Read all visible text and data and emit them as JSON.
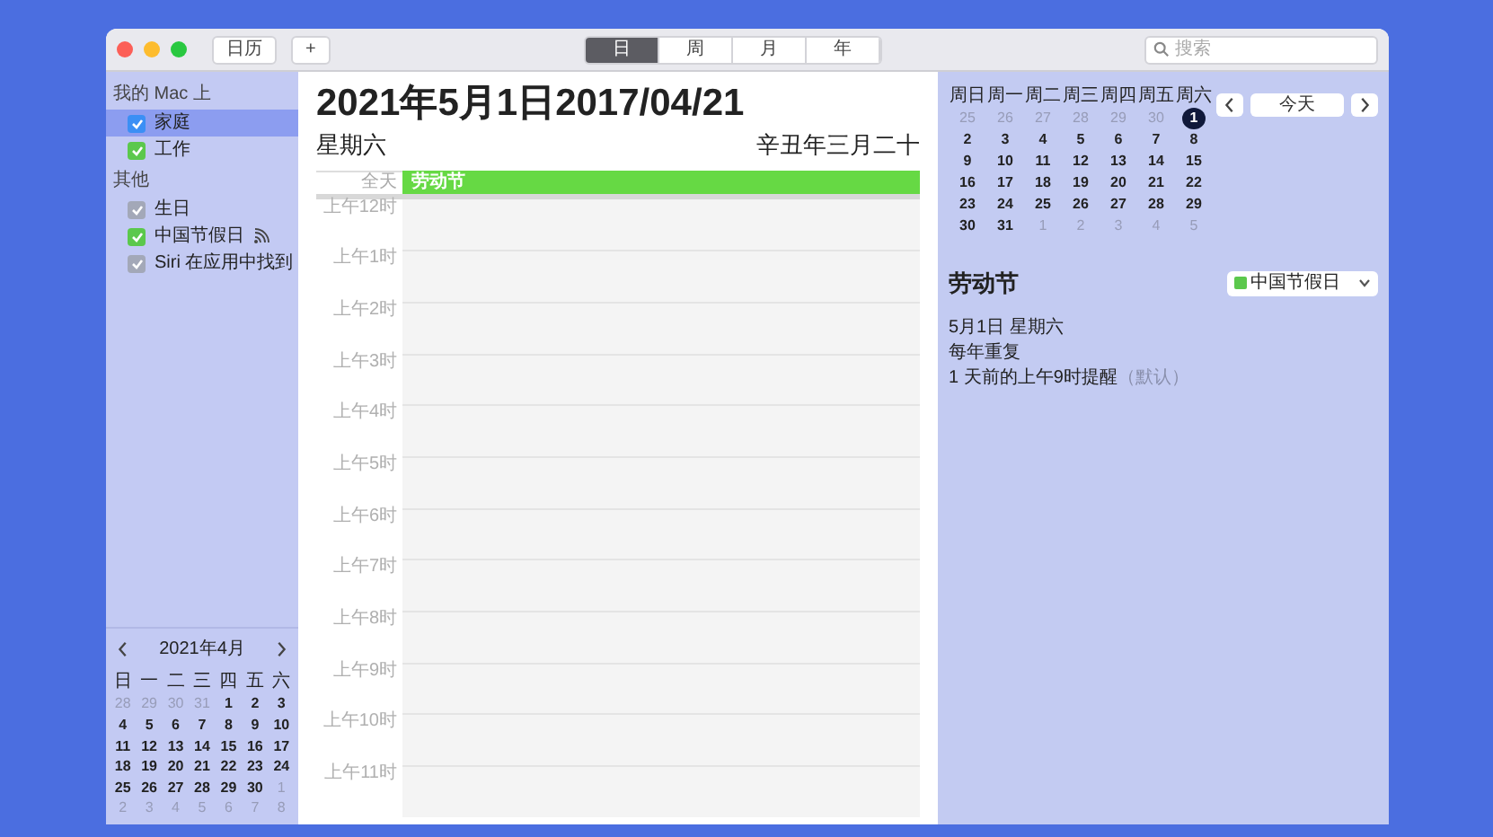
{
  "toolbar": {
    "buttons": [
      {
        "kind": "text",
        "label": "日历"
      },
      {
        "kind": "text",
        "label": "+"
      }
    ],
    "view_tabs": [
      {
        "label": "日",
        "selected": true
      },
      {
        "label": "周",
        "selected": false
      },
      {
        "label": "月",
        "selected": false
      },
      {
        "label": "年",
        "selected": false
      }
    ],
    "search": {
      "placeholder": "搜索"
    }
  },
  "sidebar": {
    "groups": [
      {
        "title": "我的 Mac 上",
        "items": [
          {
            "label": "家庭",
            "checked": true,
            "color": "#3b8ff5",
            "selected": true,
            "subscribed": false
          },
          {
            "label": "工作",
            "checked": true,
            "color": "#5bc84c",
            "selected": false,
            "subscribed": false
          }
        ]
      },
      {
        "title": "其他",
        "items": [
          {
            "label": "生日",
            "checked": true,
            "color": "#a3a8b8",
            "selected": false,
            "subscribed": false
          },
          {
            "label": "中国节假日",
            "checked": true,
            "color": "#5bc84c",
            "selected": false,
            "subscribed": true
          },
          {
            "label": "Siri 在应用中找到",
            "checked": true,
            "color": "#a3a8b8",
            "selected": false,
            "subscribed": false
          }
        ]
      }
    ],
    "mini_calendar": {
      "title": "2021年4月",
      "weekdays": [
        "日",
        "一",
        "二",
        "三",
        "四",
        "五",
        "六"
      ],
      "days": [
        {
          "text": "28",
          "current_month": false
        },
        {
          "text": "29",
          "current_month": false
        },
        {
          "text": "30",
          "current_month": false
        },
        {
          "text": "31",
          "current_month": false
        },
        {
          "text": "1",
          "current_month": true
        },
        {
          "text": "2",
          "current_month": true
        },
        {
          "text": "3",
          "current_month": true
        },
        {
          "text": "4",
          "current_month": true
        },
        {
          "text": "5",
          "current_month": true
        },
        {
          "text": "6",
          "current_month": true
        },
        {
          "text": "7",
          "current_month": true
        },
        {
          "text": "8",
          "current_month": true
        },
        {
          "text": "9",
          "current_month": true
        },
        {
          "text": "10",
          "current_month": true
        },
        {
          "text": "11",
          "current_month": true
        },
        {
          "text": "12",
          "current_month": true
        },
        {
          "text": "13",
          "current_month": true
        },
        {
          "text": "14",
          "current_month": true
        },
        {
          "text": "15",
          "current_month": true
        },
        {
          "text": "16",
          "current_month": true
        },
        {
          "text": "17",
          "current_month": true
        },
        {
          "text": "18",
          "current_month": true
        },
        {
          "text": "19",
          "current_month": true
        },
        {
          "text": "20",
          "current_month": true
        },
        {
          "text": "21",
          "current_month": true
        },
        {
          "text": "22",
          "current_month": true
        },
        {
          "text": "23",
          "current_month": true
        },
        {
          "text": "24",
          "current_month": true
        },
        {
          "text": "25",
          "current_month": true
        },
        {
          "text": "26",
          "current_month": true
        },
        {
          "text": "27",
          "current_month": true
        },
        {
          "text": "28",
          "current_month": true
        },
        {
          "text": "29",
          "current_month": true
        },
        {
          "text": "30",
          "current_month": true
        },
        {
          "text": "1",
          "current_month": false
        },
        {
          "text": "2",
          "current_month": false
        },
        {
          "text": "3",
          "current_month": false
        },
        {
          "text": "4",
          "current_month": false
        },
        {
          "text": "5",
          "current_month": false
        },
        {
          "text": "6",
          "current_month": false
        },
        {
          "text": "7",
          "current_month": false
        },
        {
          "text": "8",
          "current_month": false
        }
      ]
    }
  },
  "day_view": {
    "date_title": "2021年5月1日2017/04/21",
    "weekday": "星期六",
    "lunar_date": "辛丑年三月二十",
    "all_day_label": "全天",
    "all_day_events": [
      {
        "title": "劳动节",
        "color": "#66d944"
      }
    ],
    "hours": [
      "上午12时",
      "上午1时",
      "上午2时",
      "上午3时",
      "上午4时",
      "上午5时",
      "上午6时",
      "上午7时",
      "上午8时",
      "上午9时",
      "上午10时",
      "上午11时"
    ]
  },
  "inspector": {
    "month": {
      "weekdays": [
        "周日",
        "周一",
        "周二",
        "周三",
        "周四",
        "周五",
        "周六"
      ],
      "days": [
        {
          "text": "25",
          "current_month": false,
          "selected": false
        },
        {
          "text": "26",
          "current_month": false,
          "selected": false
        },
        {
          "text": "27",
          "current_month": false,
          "selected": false
        },
        {
          "text": "28",
          "current_month": false,
          "selected": false
        },
        {
          "text": "29",
          "current_month": false,
          "selected": false
        },
        {
          "text": "30",
          "current_month": false,
          "selected": false
        },
        {
          "text": "1",
          "current_month": true,
          "selected": true
        },
        {
          "text": "2",
          "current_month": true,
          "selected": false
        },
        {
          "text": "3",
          "current_month": true,
          "selected": false
        },
        {
          "text": "4",
          "current_month": true,
          "selected": false
        },
        {
          "text": "5",
          "current_month": true,
          "selected": false
        },
        {
          "text": "6",
          "current_month": true,
          "selected": false
        },
        {
          "text": "7",
          "current_month": true,
          "selected": false
        },
        {
          "text": "8",
          "current_month": true,
          "selected": false
        },
        {
          "text": "9",
          "current_month": true,
          "selected": false
        },
        {
          "text": "10",
          "current_month": true,
          "selected": false
        },
        {
          "text": "11",
          "current_month": true,
          "selected": false
        },
        {
          "text": "12",
          "current_month": true,
          "selected": false
        },
        {
          "text": "13",
          "current_month": true,
          "selected": false
        },
        {
          "text": "14",
          "current_month": true,
          "selected": false
        },
        {
          "text": "15",
          "current_month": true,
          "selected": false
        },
        {
          "text": "16",
          "current_month": true,
          "selected": false
        },
        {
          "text": "17",
          "current_month": true,
          "selected": false
        },
        {
          "text": "18",
          "current_month": true,
          "selected": false
        },
        {
          "text": "19",
          "current_month": true,
          "selected": false
        },
        {
          "text": "20",
          "current_month": true,
          "selected": false
        },
        {
          "text": "21",
          "current_month": true,
          "selected": false
        },
        {
          "text": "22",
          "current_month": true,
          "selected": false
        },
        {
          "text": "23",
          "current_month": true,
          "selected": false
        },
        {
          "text": "24",
          "current_month": true,
          "selected": false
        },
        {
          "text": "25",
          "current_month": true,
          "selected": false
        },
        {
          "text": "26",
          "current_month": true,
          "selected": false
        },
        {
          "text": "27",
          "current_month": true,
          "selected": false
        },
        {
          "text": "28",
          "current_month": true,
          "selected": false
        },
        {
          "text": "29",
          "current_month": true,
          "selected": false
        },
        {
          "text": "30",
          "current_month": true,
          "selected": false
        },
        {
          "text": "31",
          "current_month": true,
          "selected": false
        },
        {
          "text": "1",
          "current_month": false,
          "selected": false
        },
        {
          "text": "2",
          "current_month": false,
          "selected": false
        },
        {
          "text": "3",
          "current_month": false,
          "selected": false
        },
        {
          "text": "4",
          "current_month": false,
          "selected": false
        },
        {
          "text": "5",
          "current_month": false,
          "selected": false
        }
      ]
    },
    "today_button": "今天",
    "event": {
      "title": "劳动节",
      "calendar": {
        "label": "中国节假日",
        "color": "#5bc84c"
      },
      "date": "5月1日 星期六",
      "repeat": "每年重复",
      "alert": "1 天前的上午9时提醒",
      "alert_note": "（默认）"
    }
  }
}
